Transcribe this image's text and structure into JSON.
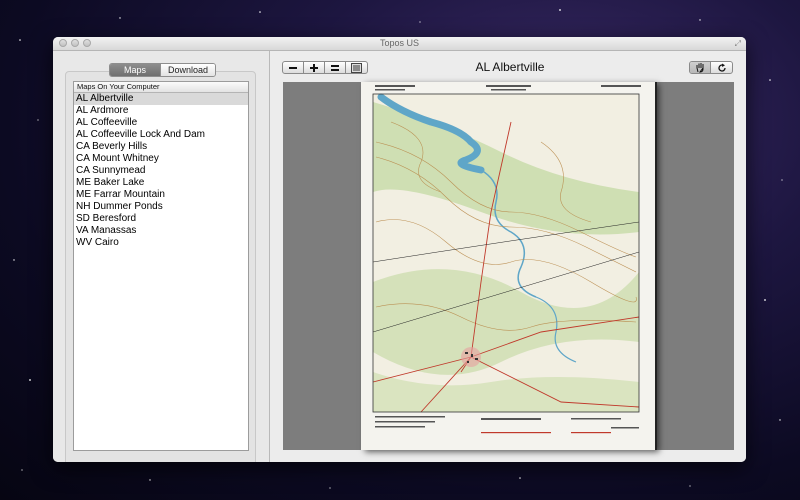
{
  "window": {
    "title": "Topos US"
  },
  "sidebar": {
    "tabs": [
      {
        "label": "Maps",
        "active": true
      },
      {
        "label": "Download",
        "active": false
      }
    ],
    "list_header": "Maps On Your Computer",
    "items": [
      {
        "label": "AL Albertville",
        "selected": true
      },
      {
        "label": "AL Ardmore"
      },
      {
        "label": "AL Coffeeville"
      },
      {
        "label": "AL Coffeeville Lock And Dam"
      },
      {
        "label": "CA Beverly Hills"
      },
      {
        "label": "CA Mount Whitney"
      },
      {
        "label": "CA Sunnymead"
      },
      {
        "label": "ME Baker Lake"
      },
      {
        "label": "ME Farrar Mountain"
      },
      {
        "label": "NH Dummer Ponds"
      },
      {
        "label": "SD Beresford"
      },
      {
        "label": "VA Manassas"
      },
      {
        "label": "WV Cairo"
      }
    ]
  },
  "toolbar": {
    "zoom_out_icon": "minus-icon",
    "zoom_in_icon": "plus-icon",
    "actual_size_icon": "equals-icon",
    "image_icon": "image-icon",
    "pan_icon": "hand-icon",
    "rotate_icon": "rotate-icon"
  },
  "map": {
    "title": "AL Albertville"
  },
  "colors": {
    "map_water": "#5fa6c8",
    "map_forest": "#c7dba8",
    "map_contour": "#b8894a",
    "map_road": "#c0392b",
    "viewer_background": "#7d7d7d"
  }
}
